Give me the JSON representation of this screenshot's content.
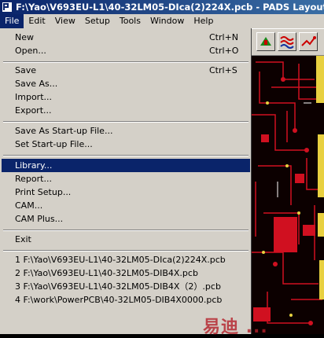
{
  "window": {
    "title": "F:\\Yao\\V693EU-L1\\40-32LM05-DIca(2)224X.pcb - PADS Layout"
  },
  "menubar": [
    "File",
    "Edit",
    "View",
    "Setup",
    "Tools",
    "Window",
    "Help"
  ],
  "file_menu": {
    "items": [
      {
        "label": "New",
        "shortcut": "Ctrl+N"
      },
      {
        "label": "Open...",
        "shortcut": "Ctrl+O"
      },
      {
        "label": "Save",
        "shortcut": "Ctrl+S"
      },
      {
        "label": "Save As...",
        "shortcut": ""
      },
      {
        "label": "Import...",
        "shortcut": ""
      },
      {
        "label": "Export...",
        "shortcut": ""
      },
      {
        "label": "Save As Start-up File...",
        "shortcut": ""
      },
      {
        "label": "Set Start-up File...",
        "shortcut": ""
      },
      {
        "label": "Library...",
        "shortcut": "",
        "highlighted": true
      },
      {
        "label": "Report...",
        "shortcut": ""
      },
      {
        "label": "Print Setup...",
        "shortcut": ""
      },
      {
        "label": "CAM...",
        "shortcut": ""
      },
      {
        "label": "CAM Plus...",
        "shortcut": ""
      },
      {
        "label": "Exit",
        "shortcut": ""
      }
    ],
    "recent_files": [
      "1 F:\\Yao\\V693EU-L1\\40-32LM05-DIca(2)224X.pcb",
      "2 F:\\Yao\\V693EU-L1\\40-32LM05-DIB4X.pcb",
      "3 F:\\Yao\\V693EU-L1\\40-32LM05-DIB4X（2）.pcb",
      "4 F:\\work\\PowerPCB\\40-32LM05-DIB4X0000.pcb"
    ]
  },
  "watermark": "易迪 ...",
  "icons": [
    "pads-app-icon",
    "snap-icon",
    "route-icon",
    "trace-icon"
  ],
  "colors": {
    "title_bar": "#0a246a",
    "highlight": "#0a246a",
    "menu_bg": "#d4d0c8",
    "pcb_trace": "#d01020",
    "pcb_copper": "#e8d040"
  }
}
